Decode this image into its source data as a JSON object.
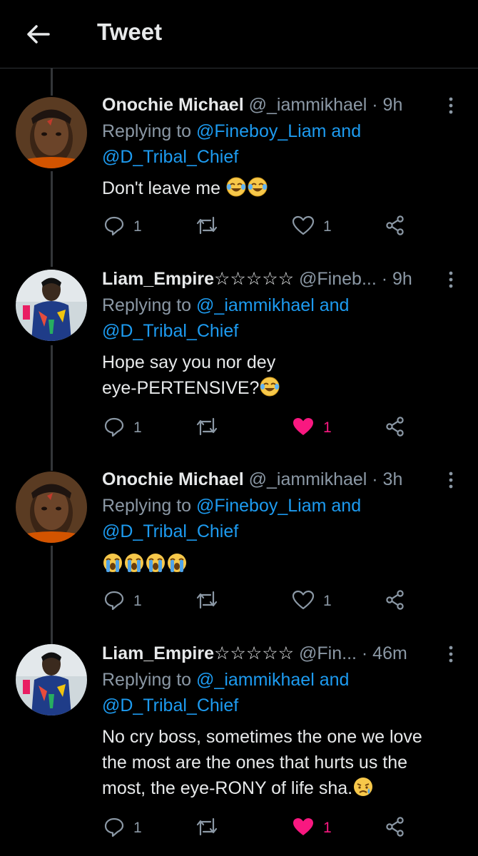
{
  "header": {
    "title": "Tweet"
  },
  "colors": {
    "link": "#1d9bf0",
    "muted": "#8b98a5",
    "like_active": "#f91880"
  },
  "tweets": [
    {
      "name": "Onochie Michael",
      "handle_time": " @_iammikhael · 9h",
      "replying_label": "Replying to ",
      "reply_to_1": "@Fineboy_Liam and",
      "reply_to_2": "@D_Tribal_Chief",
      "text_lines": [
        "Don't leave me"
      ],
      "emojis": [
        "face-with-tears-of-joy",
        "face-with-tears-of-joy"
      ],
      "replies": "1",
      "likes": "1",
      "liked": false
    },
    {
      "name": "Liam_Empire☆☆☆☆☆",
      "handle_time": " @Fineb... · 9h",
      "replying_label": "Replying to ",
      "reply_to_1": "@_iammikhael and",
      "reply_to_2": "@D_Tribal_Chief",
      "text_lines": [
        "Hope say you nor dey",
        "eye-PERTENSIVE?"
      ],
      "emojis": [
        "face-with-tears-of-joy"
      ],
      "replies": "1",
      "likes": "1",
      "liked": true
    },
    {
      "name": "Onochie Michael",
      "handle_time": " @_iammikhael · 3h",
      "replying_label": "Replying to ",
      "reply_to_1": "@Fineboy_Liam and",
      "reply_to_2": "@D_Tribal_Chief",
      "text_lines": [],
      "emojis": [
        "loudly-crying-face",
        "loudly-crying-face",
        "loudly-crying-face",
        "loudly-crying-face"
      ],
      "replies": "1",
      "likes": "1",
      "liked": false
    },
    {
      "name": "Liam_Empire☆☆☆☆☆",
      "handle_time": " @Fin...  · 46m",
      "replying_label": "Replying to ",
      "reply_to_1": "@_iammikhael and",
      "reply_to_2": "@D_Tribal_Chief",
      "text_lines": [
        "No cry boss, sometimes the one we love",
        "the most are the ones that hurts us the",
        "most, the eye-RONY of life sha."
      ],
      "emojis": [
        "sad-but-relieved-face"
      ],
      "replies": "1",
      "likes": "1",
      "liked": true
    }
  ]
}
